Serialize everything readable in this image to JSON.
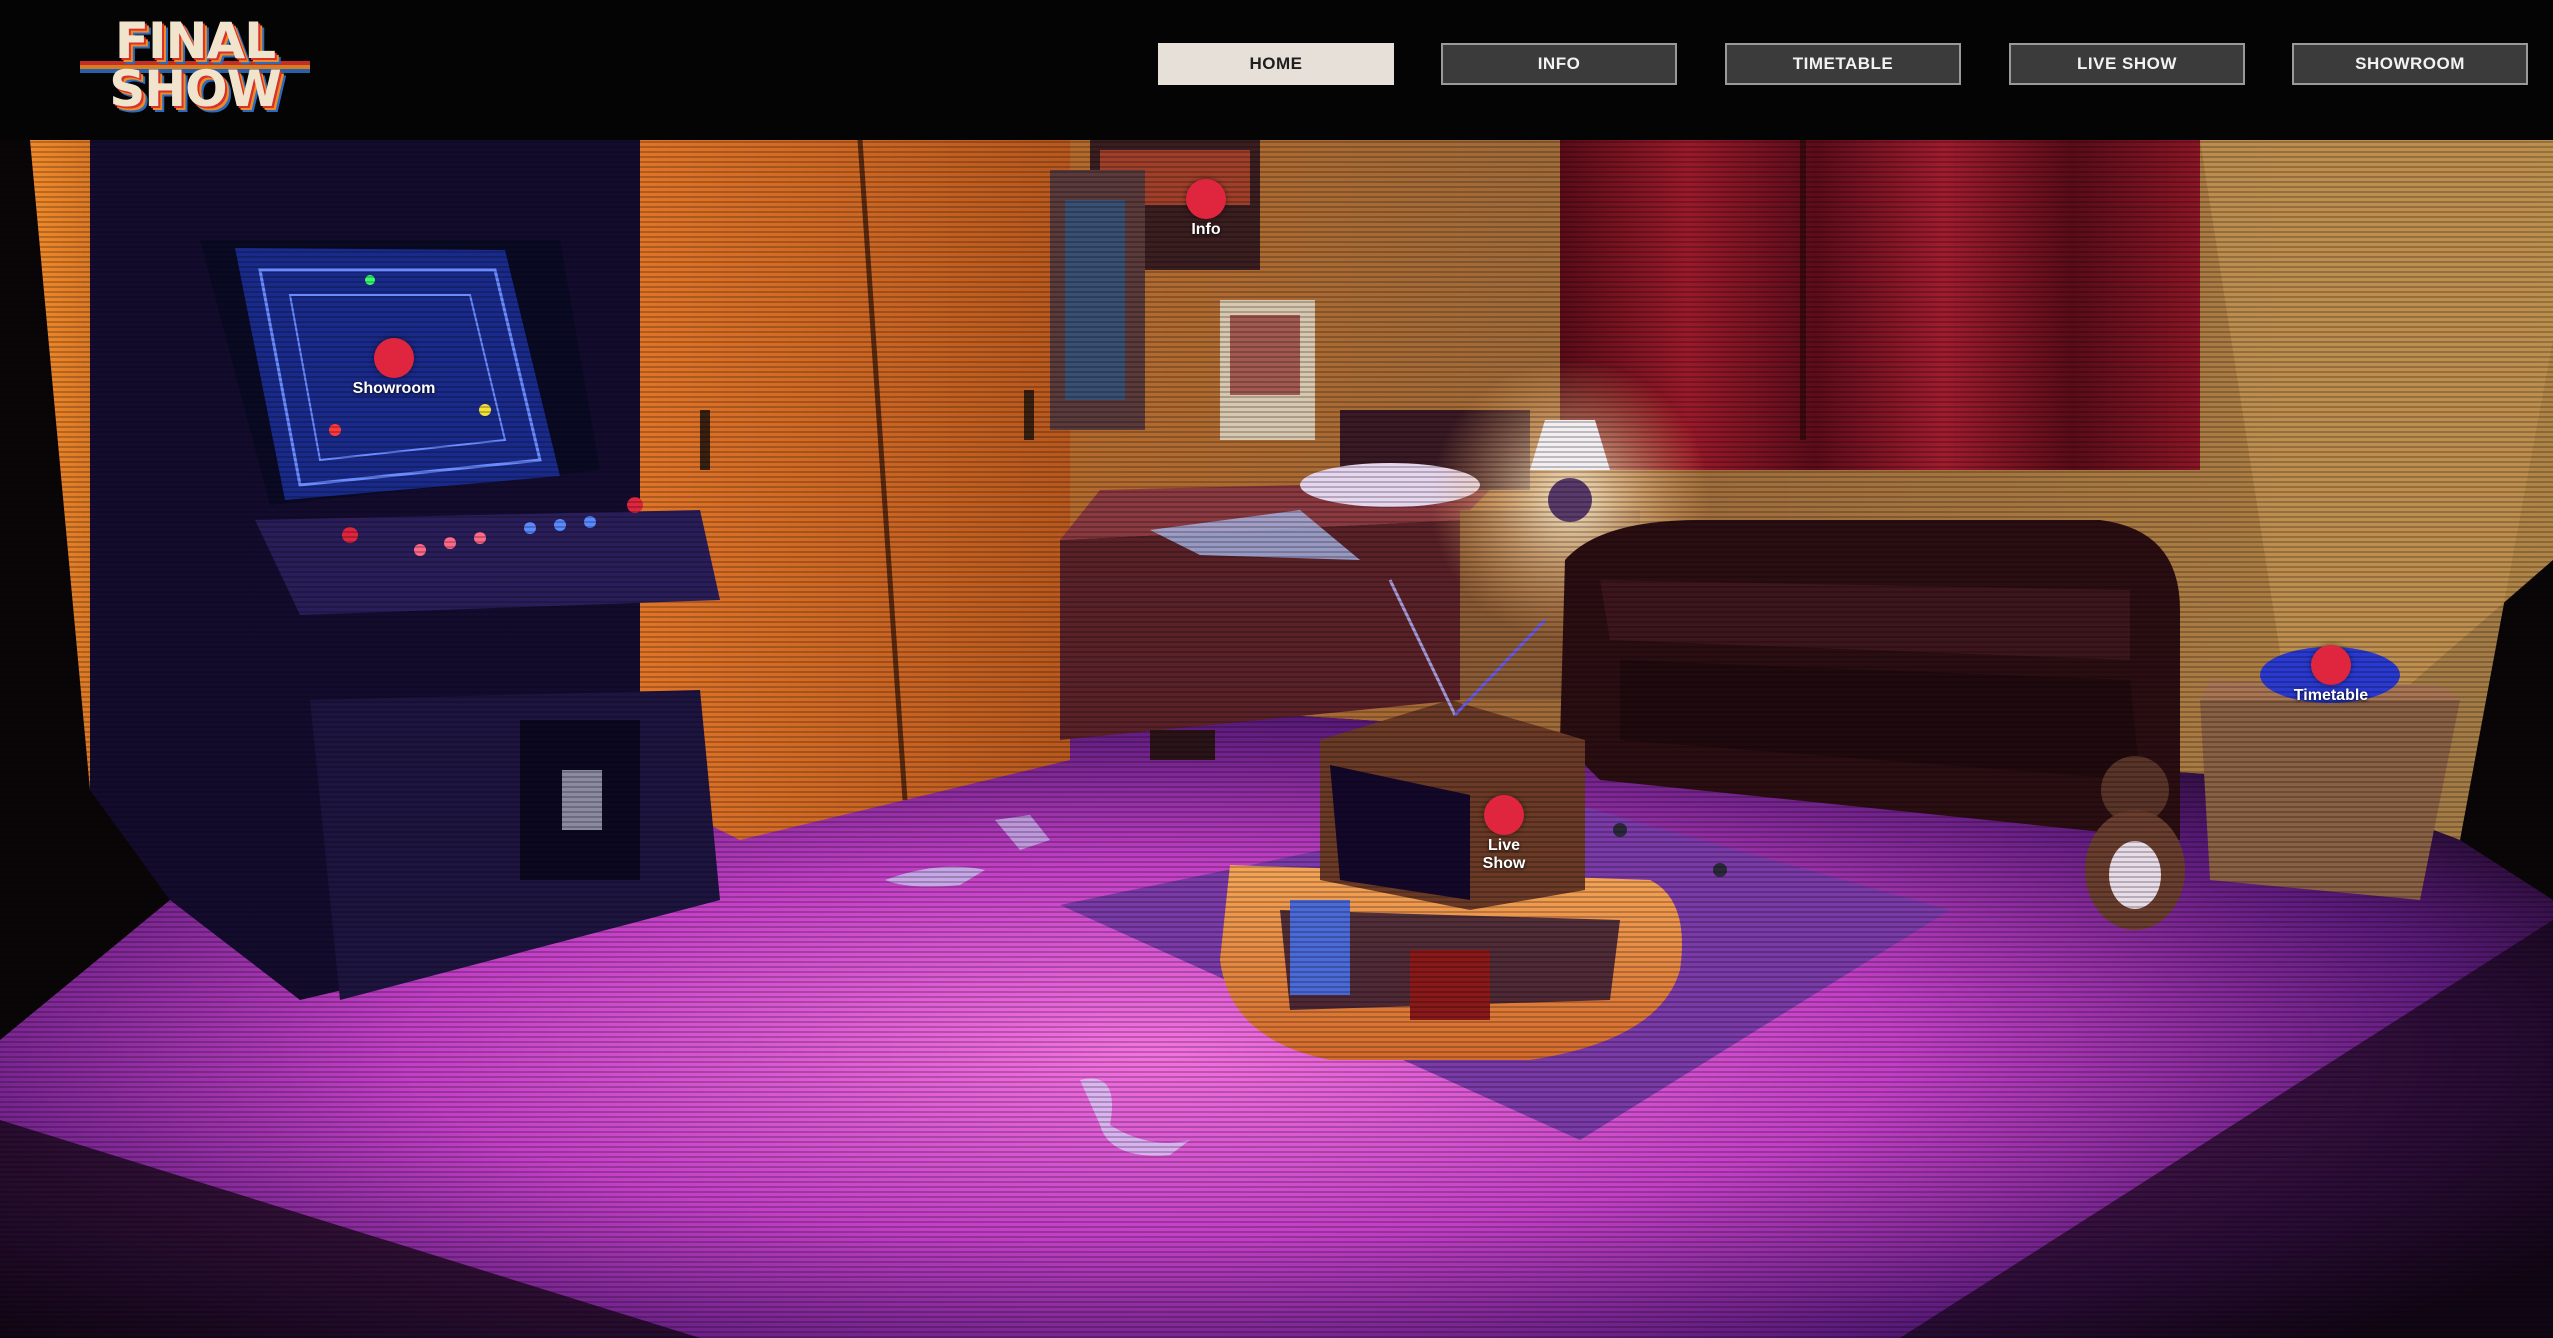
{
  "header": {
    "logo": {
      "line1": "FINAL",
      "line2": "SHOW"
    },
    "nav": [
      {
        "label": "HOME",
        "active": true
      },
      {
        "label": "INFO",
        "active": false
      },
      {
        "label": "TIMETABLE",
        "active": false
      },
      {
        "label": "LIVE SHOW",
        "active": false
      },
      {
        "label": "SHOWROOM",
        "active": false
      }
    ]
  },
  "hotspots": {
    "showroom": "Showroom",
    "info": "Info",
    "live_show": "Live Show",
    "timetable": "Timetable"
  },
  "colors": {
    "hotspot": "#e0263e",
    "nav_active_bg": "#e6e0d8",
    "nav_bg": "#3b3b3b",
    "floor_pink": "#d04ad8",
    "wall_orange": "#e0782a"
  }
}
